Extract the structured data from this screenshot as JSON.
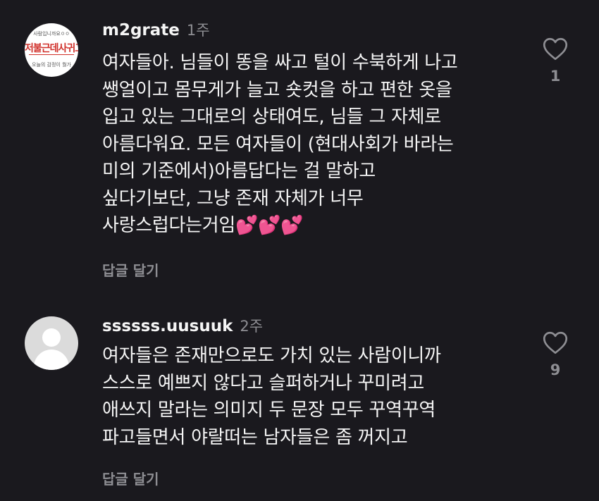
{
  "comments": [
    {
      "avatar": {
        "line1": "사람입니까요ㅇㅇ",
        "line2": "저불근데사귀고싶",
        "line3": "오늘의 감정이 뭘가"
      },
      "username": "m2grate",
      "time": "1주",
      "text": "여자들아. 님들이 똥을 싸고 털이 수북하게 나고\n쌩얼이고 몸무게가 늘고 숏컷을 하고 편한 옷을\n입고 있는 그대로의 상태여도, 님들 그 자체로\n아름다워요. 모든 여자들이 (현대사회가 바라는\n미의 기준에서)아름답다는 걸 말하고\n싶다기보단, 그냥 존재 자체가 너무\n사랑스럽다는거임💕💕💕",
      "reply_label": "답글 달기",
      "like_icon": "heart-outline-icon",
      "likes": "1"
    },
    {
      "username": "ssssss.uusuuk",
      "time": "2주",
      "text": "여자들은 존재만으로도 가치 있는 사람이니까\n스스로 예쁘지 않다고 슬퍼하거나 꾸미려고\n애쓰지 말라는 의미지 두 문장 모두 꾸역꾸역\n파고들면서 야랄떠는 남자들은 좀 꺼지고",
      "reply_label": "답글 달기",
      "like_icon": "heart-outline-icon",
      "likes": "9"
    }
  ],
  "colors": {
    "background": "#1a191e",
    "text": "#f5f5f5",
    "muted": "#8e8e93"
  }
}
